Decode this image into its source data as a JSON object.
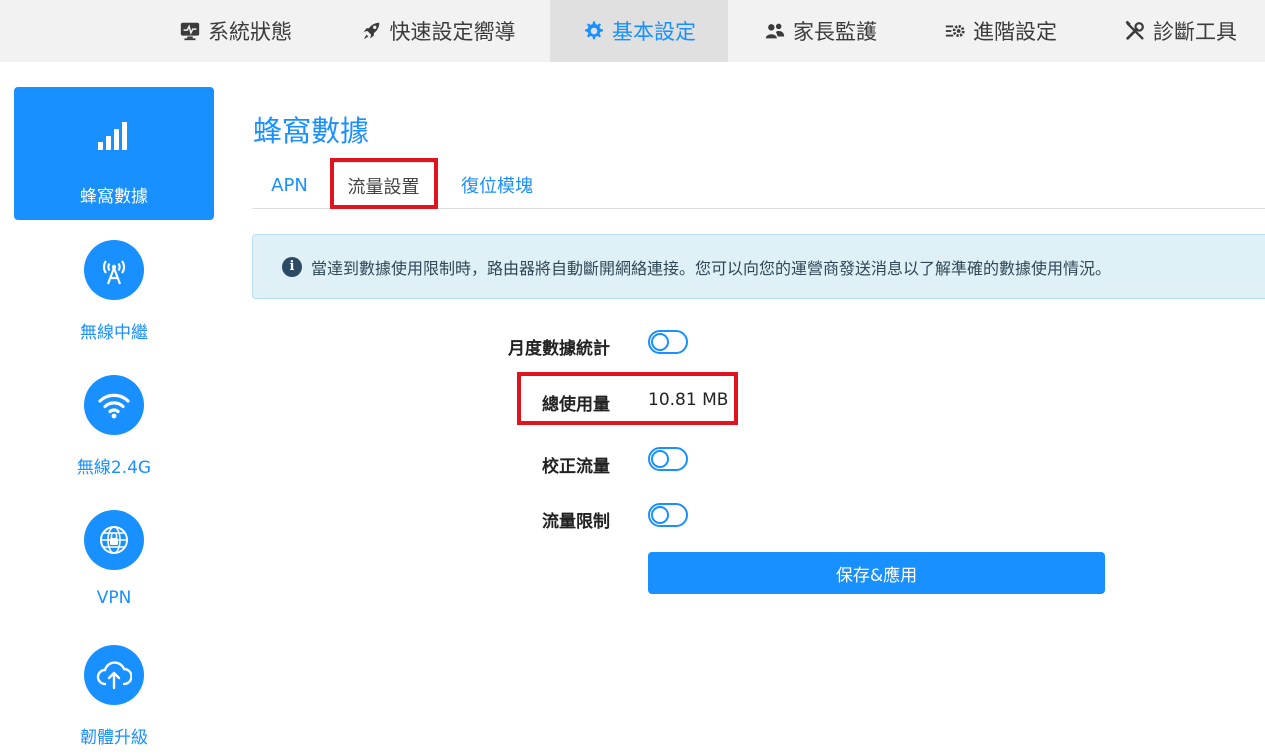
{
  "topnav": {
    "items": [
      {
        "label": "系統狀態",
        "icon": "monitor-icon"
      },
      {
        "label": "快速設定嚮導",
        "icon": "rocket-icon"
      },
      {
        "label": "基本設定",
        "icon": "gear-icon",
        "active": true
      },
      {
        "label": "家長監護",
        "icon": "users-icon"
      },
      {
        "label": "進階設定",
        "icon": "list-gear-icon"
      },
      {
        "label": "診斷工具",
        "icon": "tools-icon"
      }
    ]
  },
  "sidebar": {
    "items": [
      {
        "label": "蜂窩數據",
        "icon": "signal-bars-icon",
        "active": true
      },
      {
        "label": "無線中繼",
        "icon": "antenna-icon"
      },
      {
        "label": "無線2.4G",
        "icon": "wifi-icon"
      },
      {
        "label": "VPN",
        "icon": "globe-lock-icon"
      },
      {
        "label": "韌體升級",
        "icon": "cloud-upload-icon"
      }
    ]
  },
  "page": {
    "title": "蜂窩數據",
    "tabs": [
      {
        "label": "APN"
      },
      {
        "label": "流量設置",
        "active": true
      },
      {
        "label": "復位模塊"
      }
    ],
    "alert": {
      "icon": "info-icon",
      "glyph": "i",
      "text": "當達到數據使用限制時，路由器將自動斷開網絡連接。您可以向您的運營商發送消息以了解準確的數據使用情況。"
    },
    "form": {
      "monthly_stats_label": "月度數據統計",
      "monthly_stats_on": false,
      "total_usage_label": "總使用量",
      "total_usage_value": "10.81 MB",
      "calibrate_label": "校正流量",
      "calibrate_on": false,
      "limit_label": "流量限制",
      "limit_on": false
    },
    "save_label": "保存&應用"
  },
  "colors": {
    "accent": "#1890ff",
    "highlight": "#e0141e",
    "alert_bg": "#dff0f7"
  }
}
